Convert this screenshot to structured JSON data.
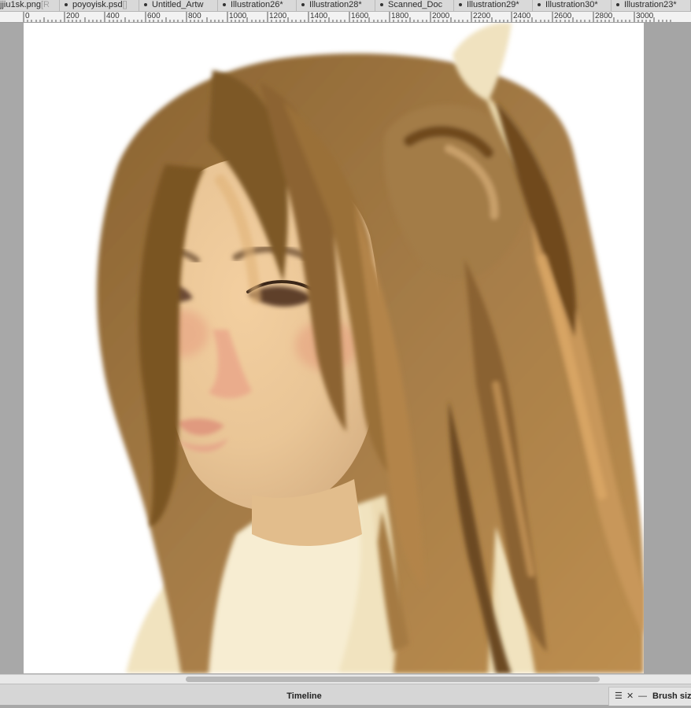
{
  "tabs": [
    {
      "name": "jjiu1sk.png",
      "suffix": "[R",
      "modified": false
    },
    {
      "name": "poyoyisk.psd",
      "suffix": "[]",
      "modified": false
    },
    {
      "name": "Untitled_Artw",
      "suffix": "",
      "modified": false
    },
    {
      "name": "Illustration26*",
      "suffix": "",
      "modified": true
    },
    {
      "name": "Illustration28*",
      "suffix": "",
      "modified": true
    },
    {
      "name": "Scanned_Doc",
      "suffix": "",
      "modified": false
    },
    {
      "name": "Illustration29*",
      "suffix": "",
      "modified": true
    },
    {
      "name": "Illustration30*",
      "suffix": "",
      "modified": true
    },
    {
      "name": "Illustration23*",
      "suffix": "",
      "modified": true
    }
  ],
  "ruler": {
    "labels": [
      "0",
      "200",
      "400",
      "600",
      "800",
      "1000",
      "1200",
      "1400",
      "1600",
      "1800",
      "2000",
      "2200",
      "2400",
      "2600",
      "2800",
      "3000"
    ]
  },
  "canvas": {
    "artwork": "digital painting portrait"
  },
  "panels": {
    "timeline_title": "Timeline",
    "brush_label": "Brush size",
    "menu_icon": "hamburger-icon",
    "close_icon": "close-icon",
    "minimize_icon": "minimize-icon"
  },
  "colors": {
    "hair_dark": "#7a5424",
    "hair_mid": "#a47a45",
    "hair_light": "#c99a58",
    "skin": "#ecc79a",
    "clothing": "#f3e6c4",
    "canvas_bg": "#ffffff",
    "workspace": "#a8a8a8"
  }
}
